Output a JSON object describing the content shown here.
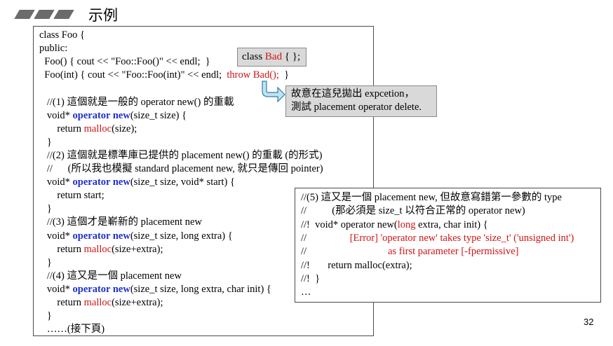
{
  "header": {
    "title": "示例"
  },
  "bad_box": {
    "prefix": "class ",
    "name": "Bad",
    "suffix": " { };"
  },
  "note": {
    "line1": "故意在這兒拋出 expcetion，",
    "line2": "測試 placement operator delete."
  },
  "page_number": "32",
  "code_lines": [
    [
      {
        "t": "class Foo {"
      }
    ],
    [
      {
        "t": "public:"
      }
    ],
    [
      {
        "t": "  Foo() { cout << \"Foo::Foo()\" << endl;  }"
      }
    ],
    [
      {
        "t": "  Foo(int) { cout << \"Foo::Foo(int)\" << endl;  "
      },
      {
        "t": "throw Bad();",
        "c": "rd"
      },
      {
        "t": "  }"
      }
    ],
    [
      {
        "t": ""
      }
    ],
    [
      {
        "t": "   //(1) 這個就是一般的 operator new() 的重載"
      }
    ],
    [
      {
        "t": "   void* "
      },
      {
        "t": "operator new",
        "c": "kw"
      },
      {
        "t": "(size_t size) {"
      }
    ],
    [
      {
        "t": "       return "
      },
      {
        "t": "malloc",
        "c": "rd"
      },
      {
        "t": "(size);"
      }
    ],
    [
      {
        "t": "   }"
      }
    ],
    [
      {
        "t": "   //(2) 這個就是標準庫已提供的 placement new() 的重載 (的形式)"
      }
    ],
    [
      {
        "t": "   //      (所以我也模擬 standard placement new, 就只是傳回 pointer)"
      }
    ],
    [
      {
        "t": "   void* "
      },
      {
        "t": "operator new",
        "c": "kw"
      },
      {
        "t": "(size_t size, void* start) {"
      }
    ],
    [
      {
        "t": "       return start;"
      }
    ],
    [
      {
        "t": "   }"
      }
    ],
    [
      {
        "t": "   //(3) 這個才是嶄新的 placement new"
      }
    ],
    [
      {
        "t": "   void* "
      },
      {
        "t": "operator new",
        "c": "kw"
      },
      {
        "t": "(size_t size, long extra) {"
      }
    ],
    [
      {
        "t": "       return "
      },
      {
        "t": "malloc",
        "c": "rd"
      },
      {
        "t": "(size+extra);"
      }
    ],
    [
      {
        "t": "   }"
      }
    ],
    [
      {
        "t": "   //(4) 這又是一個 placement new"
      }
    ],
    [
      {
        "t": "   void* "
      },
      {
        "t": "operator new",
        "c": "kw"
      },
      {
        "t": "(size_t size, long extra, char init) {"
      }
    ],
    [
      {
        "t": "       return "
      },
      {
        "t": "malloc",
        "c": "rd"
      },
      {
        "t": "(size+extra);"
      }
    ],
    [
      {
        "t": "   }"
      }
    ],
    [
      {
        "t": "   ……(接下頁)"
      }
    ]
  ],
  "box2_lines": [
    [
      {
        "t": "//(5) 這又是一個 placement new, 但故意寫錯第一參數的 type"
      }
    ],
    [
      {
        "t": "//          (那必須是 size_t 以符合正常的 operator new)"
      }
    ],
    [
      {
        "t": "//!  void* operator new("
      },
      {
        "t": "long",
        "c": "rd"
      },
      {
        "t": " extra, char init) {"
      }
    ],
    [
      {
        "t": "//                 "
      },
      {
        "t": "[Error] 'operator new' takes type 'size_t' ('unsigned int')",
        "c": "rd"
      }
    ],
    [
      {
        "t": "//                                "
      },
      {
        "t": "as first parameter [-fpermissive]",
        "c": "rd"
      }
    ],
    [
      {
        "t": "//!       return malloc(extra);"
      }
    ],
    [
      {
        "t": "//!  }"
      }
    ],
    [
      {
        "t": "…"
      }
    ]
  ]
}
